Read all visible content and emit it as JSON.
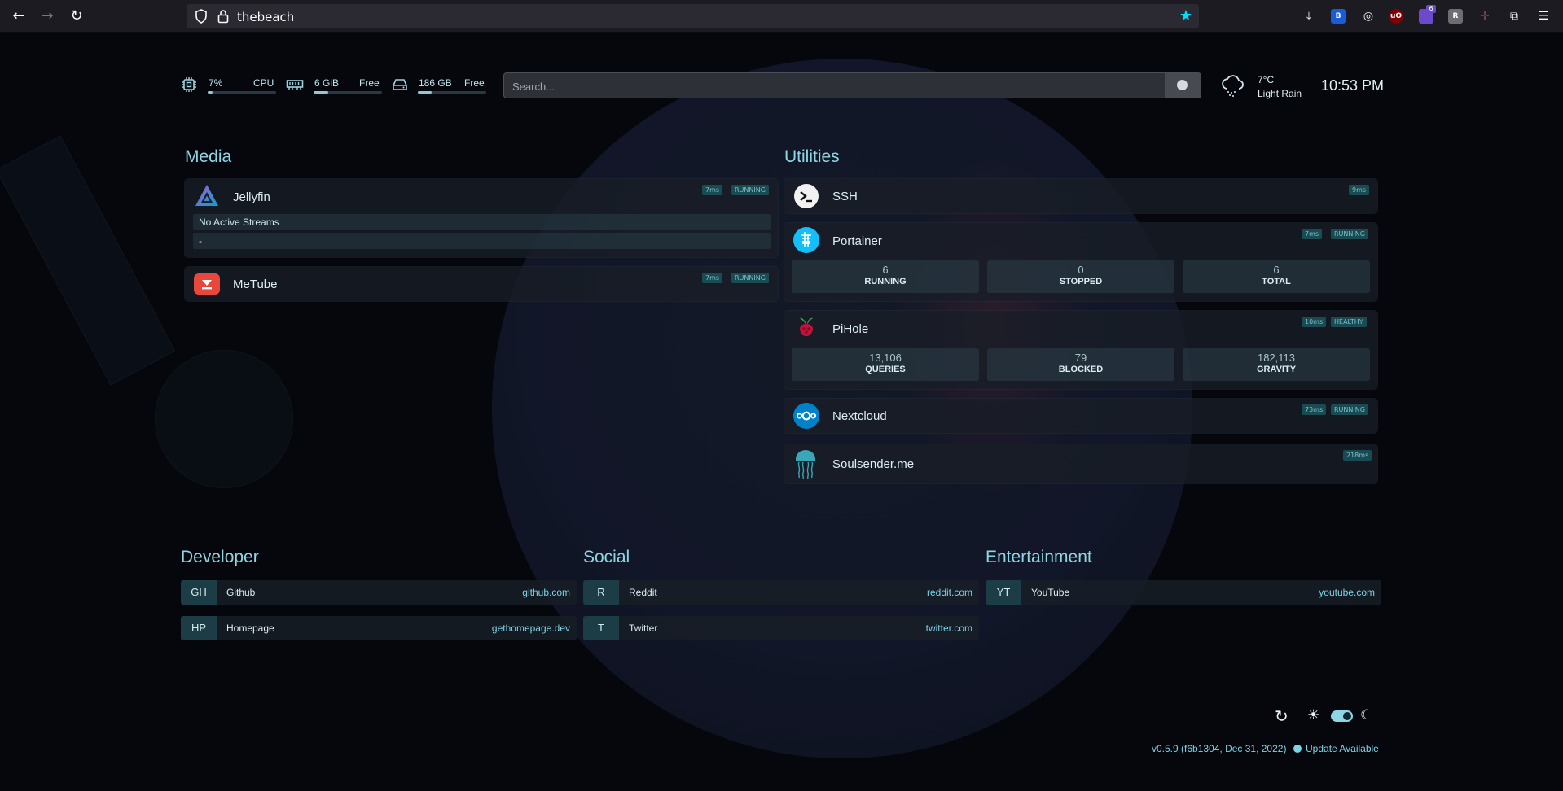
{
  "browser": {
    "url": "thebeach",
    "extension_badge": "6"
  },
  "resources": {
    "cpu": {
      "value": "7%",
      "label": "CPU",
      "usage": 0.07
    },
    "memory": {
      "value": "6 GiB",
      "label": "Free",
      "usage": 0.22
    },
    "disk": {
      "value": "186 GB",
      "label": "Free",
      "usage": 0.2
    }
  },
  "search": {
    "placeholder": "Search..."
  },
  "weather": {
    "temp": "7°C",
    "condition": "Light Rain"
  },
  "clock": {
    "time": "10:53 PM"
  },
  "media": {
    "title": "Media",
    "jellyfin": {
      "name": "Jellyfin",
      "ping": "7ms",
      "status": "RUNNING",
      "stream_text": "No Active Streams",
      "stream_sub": "-"
    },
    "metube": {
      "name": "MeTube",
      "ping": "7ms",
      "status": "RUNNING"
    }
  },
  "utilities": {
    "title": "Utilities",
    "ssh": {
      "name": "SSH",
      "ping": "9ms"
    },
    "portainer": {
      "name": "Portainer",
      "ping": "7ms",
      "status": "RUNNING",
      "stats": [
        {
          "value": "6",
          "label": "RUNNING"
        },
        {
          "value": "0",
          "label": "STOPPED"
        },
        {
          "value": "6",
          "label": "TOTAL"
        }
      ]
    },
    "pihole": {
      "name": "PiHole",
      "ping": "10ms",
      "status": "HEALTHY",
      "stats": [
        {
          "value": "13,106",
          "label": "QUERIES"
        },
        {
          "value": "79",
          "label": "BLOCKED"
        },
        {
          "value": "182,113",
          "label": "GRAVITY"
        }
      ]
    },
    "nextcloud": {
      "name": "Nextcloud",
      "ping": "73ms",
      "status": "RUNNING"
    },
    "soulsender": {
      "name": "Soulsender.me",
      "ping": "218ms"
    }
  },
  "developer": {
    "title": "Developer",
    "items": [
      {
        "abbr": "GH",
        "name": "Github",
        "url": "github.com"
      },
      {
        "abbr": "HP",
        "name": "Homepage",
        "url": "gethomepage.dev"
      }
    ]
  },
  "social": {
    "title": "Social",
    "items": [
      {
        "abbr": "R",
        "name": "Reddit",
        "url": "reddit.com"
      },
      {
        "abbr": "T",
        "name": "Twitter",
        "url": "twitter.com"
      }
    ]
  },
  "entertainment": {
    "title": "Entertainment",
    "items": [
      {
        "abbr": "YT",
        "name": "YouTube",
        "url": "youtube.com"
      }
    ]
  },
  "footer": {
    "version": "v0.5.9 (f6b1304, Dec 31, 2022)",
    "update": "Update Available"
  },
  "colors": {
    "accent": "#8fd6e4",
    "badge_bg": "#184b52",
    "background": "#05070d"
  }
}
